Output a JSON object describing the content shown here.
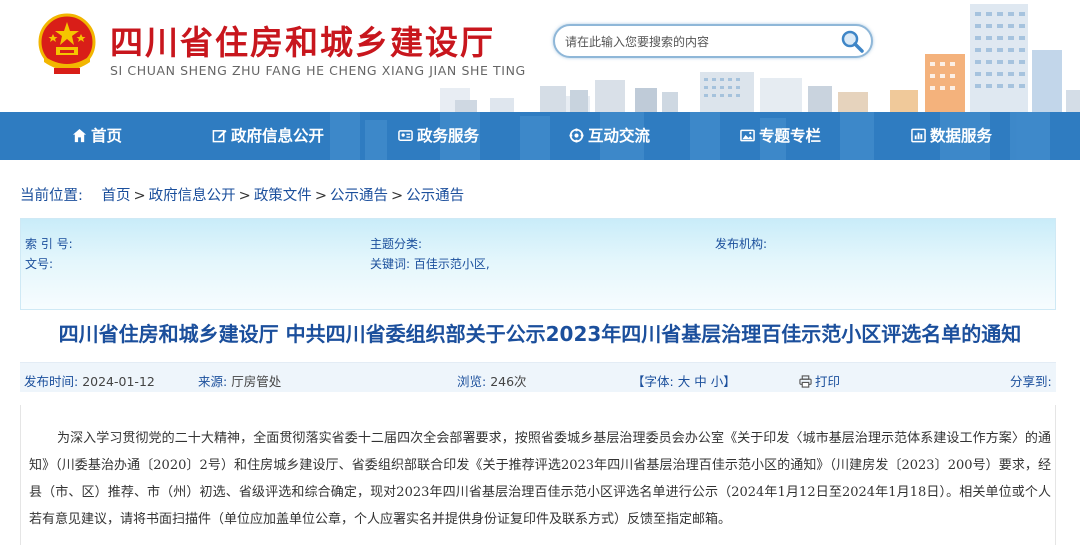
{
  "header": {
    "site_title": "四川省住房和城乡建设厅",
    "site_pinyin": "SI CHUAN SHENG ZHU FANG HE CHENG XIANG JIAN SHE TING",
    "search_placeholder": "请在此输入您要搜索的内容",
    "colors": {
      "title_red": "#c8161d",
      "nav_blue": "#2f7cc1",
      "link_blue": "#1b4f9c"
    }
  },
  "nav": {
    "items": [
      {
        "label": "首页",
        "icon": "home-icon"
      },
      {
        "label": "政府信息公开",
        "icon": "edit-icon"
      },
      {
        "label": "政务服务",
        "icon": "id-card-icon"
      },
      {
        "label": "互动交流",
        "icon": "chat-icon"
      },
      {
        "label": "专题专栏",
        "icon": "image-icon"
      },
      {
        "label": "数据服务",
        "icon": "data-icon"
      }
    ]
  },
  "breadcrumb": {
    "label": "当前位置:",
    "items": [
      "首页",
      "政府信息公开",
      "政策文件",
      "公示通告",
      "公示通告"
    ]
  },
  "meta": {
    "index_label": "索 引 号:",
    "category_label": "主题分类:",
    "publisher_label": "发布机构:",
    "doc_no_label": "文号:",
    "keywords_label": "关键词:",
    "keywords_value": "百佳示范小区,"
  },
  "document": {
    "title": "四川省住房和城乡建设厅 中共四川省委组织部关于公示2023年四川省基层治理百佳示范小区评选名单的通知",
    "publish_time_label": "发布时间:",
    "publish_time": "2024-01-12",
    "source_label": "来源:",
    "source": "厅房管处",
    "views_label": "浏览:",
    "views": "246次",
    "font_size_label": "【字体:",
    "font_large": "大",
    "font_medium": "中",
    "font_small": "小】",
    "print_label": "打印",
    "share_label": "分享到:",
    "body": "为深入学习贯彻党的二十大精神，全面贯彻落实省委十二届四次全会部署要求，按照省委城乡基层治理委员会办公室《关于印发〈城市基层治理示范体系建设工作方案〉的通知》（川委基治办通〔2020〕2号）和住房城乡建设厅、省委组织部联合印发《关于推荐评选2023年四川省基层治理百佳示范小区的通知》（川建房发〔2023〕200号）要求，经县（市、区）推荐、市（州）初选、省级评选和综合确定，现对2023年四川省基层治理百佳示范小区评选名单进行公示（2024年1月12日至2024年1月18日）。相关单位或个人若有意见建议，请将书面扫描件（单位应加盖单位公章，个人应署实名并提供身份证复印件及联系方式）反馈至指定邮箱。"
  }
}
